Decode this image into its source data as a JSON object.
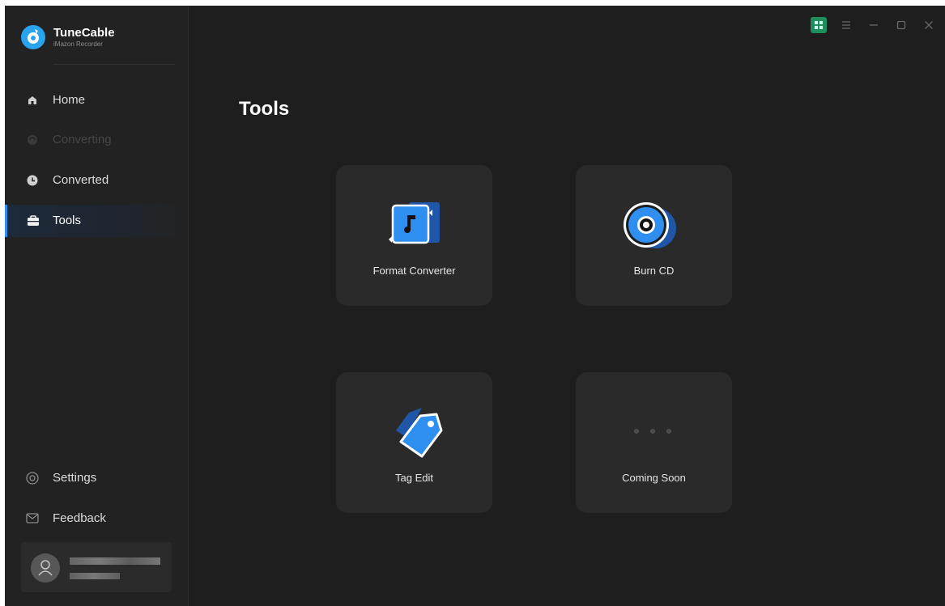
{
  "brand": {
    "title": "TuneCable",
    "subtitle": "iMazon Recorder"
  },
  "nav": {
    "home": "Home",
    "converting": "Converting",
    "converted": "Converted",
    "tools": "Tools",
    "settings": "Settings",
    "feedback": "Feedback"
  },
  "page_title": "Tools",
  "cards": {
    "format_converter": "Format Converter",
    "burn_cd": "Burn CD",
    "tag_edit": "Tag Edit",
    "coming_soon": "Coming Soon"
  },
  "colors": {
    "accent": "#2f8ff0",
    "background": "#1e1e1e",
    "sidebar": "#222222",
    "card": "#2a2a2a"
  },
  "icons": [
    "logo-icon",
    "home-icon",
    "converting-icon",
    "converted-icon",
    "tools-icon",
    "settings-icon",
    "feedback-icon",
    "user-avatar-icon",
    "grid-view-icon",
    "menu-icon",
    "minimize-icon",
    "maximize-icon",
    "close-icon",
    "format-converter-icon",
    "burn-cd-icon",
    "tag-edit-icon",
    "more-dots-icon"
  ]
}
